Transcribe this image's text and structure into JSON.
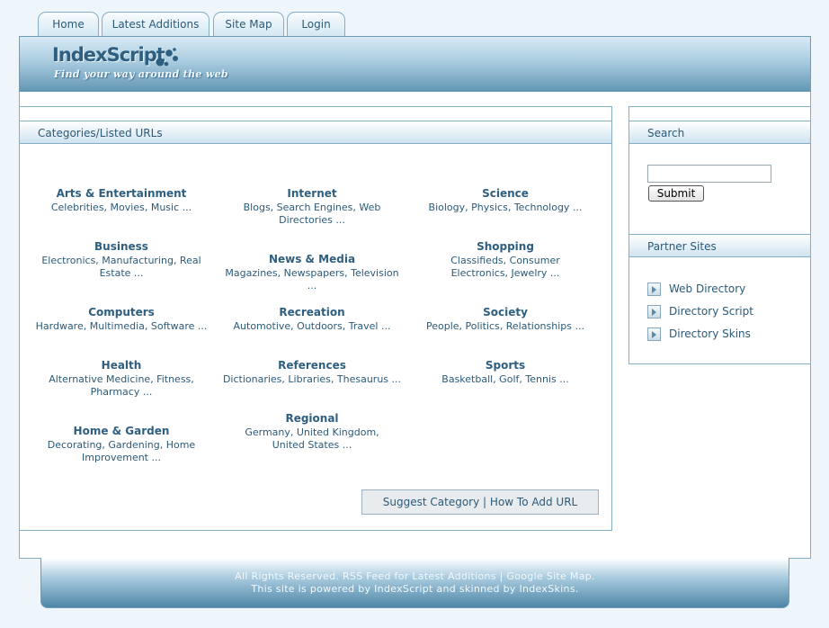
{
  "nav": {
    "tabs": [
      {
        "label": "Home"
      },
      {
        "label": "Latest Additions"
      },
      {
        "label": "Site Map"
      },
      {
        "label": "Login"
      }
    ]
  },
  "header": {
    "logo_title": "IndexScript",
    "tagline": "Find your way around the web"
  },
  "main": {
    "panel_title": "Categories/Listed URLs",
    "categories": [
      {
        "title": "Arts & Entertainment",
        "sub": "Celebrities, Movies, Music ..."
      },
      {
        "title": "Internet",
        "sub": "Blogs, Search Engines, Web Directories ..."
      },
      {
        "title": "Science",
        "sub": "Biology, Physics, Technology ..."
      },
      {
        "title": "Business",
        "sub": "Electronics, Manufacturing, Real Estate ..."
      },
      {
        "title": "News & Media",
        "sub": "Magazines, Newspapers, Television ..."
      },
      {
        "title": "Shopping",
        "sub": "Classifieds, Consumer Electronics, Jewelry ..."
      },
      {
        "title": "Computers",
        "sub": "Hardware, Multimedia, Software ..."
      },
      {
        "title": "Recreation",
        "sub": "Automotive, Outdoors, Travel ..."
      },
      {
        "title": "Society",
        "sub": "People, Politics, Relationships ..."
      },
      {
        "title": "Health",
        "sub": "Alternative Medicine, Fitness, Pharmacy ..."
      },
      {
        "title": "References",
        "sub": "Dictionaries, Libraries, Thesaurus ..."
      },
      {
        "title": "Sports",
        "sub": "Basketball, Golf, Tennis ..."
      },
      {
        "title": "Home & Garden",
        "sub": "Decorating, Gardening, Home Improvement ..."
      },
      {
        "title": "Regional",
        "sub": "Germany, United Kingdom, United States ..."
      }
    ],
    "suggest_label": "Suggest Category",
    "separator": "|",
    "how_to_label": "How To Add URL"
  },
  "sidebar": {
    "search_title": "Search",
    "search_value": "",
    "submit_label": "Submit",
    "partners_title": "Partner Sites",
    "partners": [
      {
        "label": "Web Directory"
      },
      {
        "label": "Directory Script"
      },
      {
        "label": "Directory Skins"
      }
    ]
  },
  "footer": {
    "line1": "All Rights Reserved. RSS Feed for Latest Additions | Google Site Map.",
    "line2": "This site is powered by IndexScript and skinned by IndexSkins."
  },
  "colors": {
    "accent": "#2b5a78",
    "border": "#84aec6",
    "background": "#eef6fb"
  }
}
